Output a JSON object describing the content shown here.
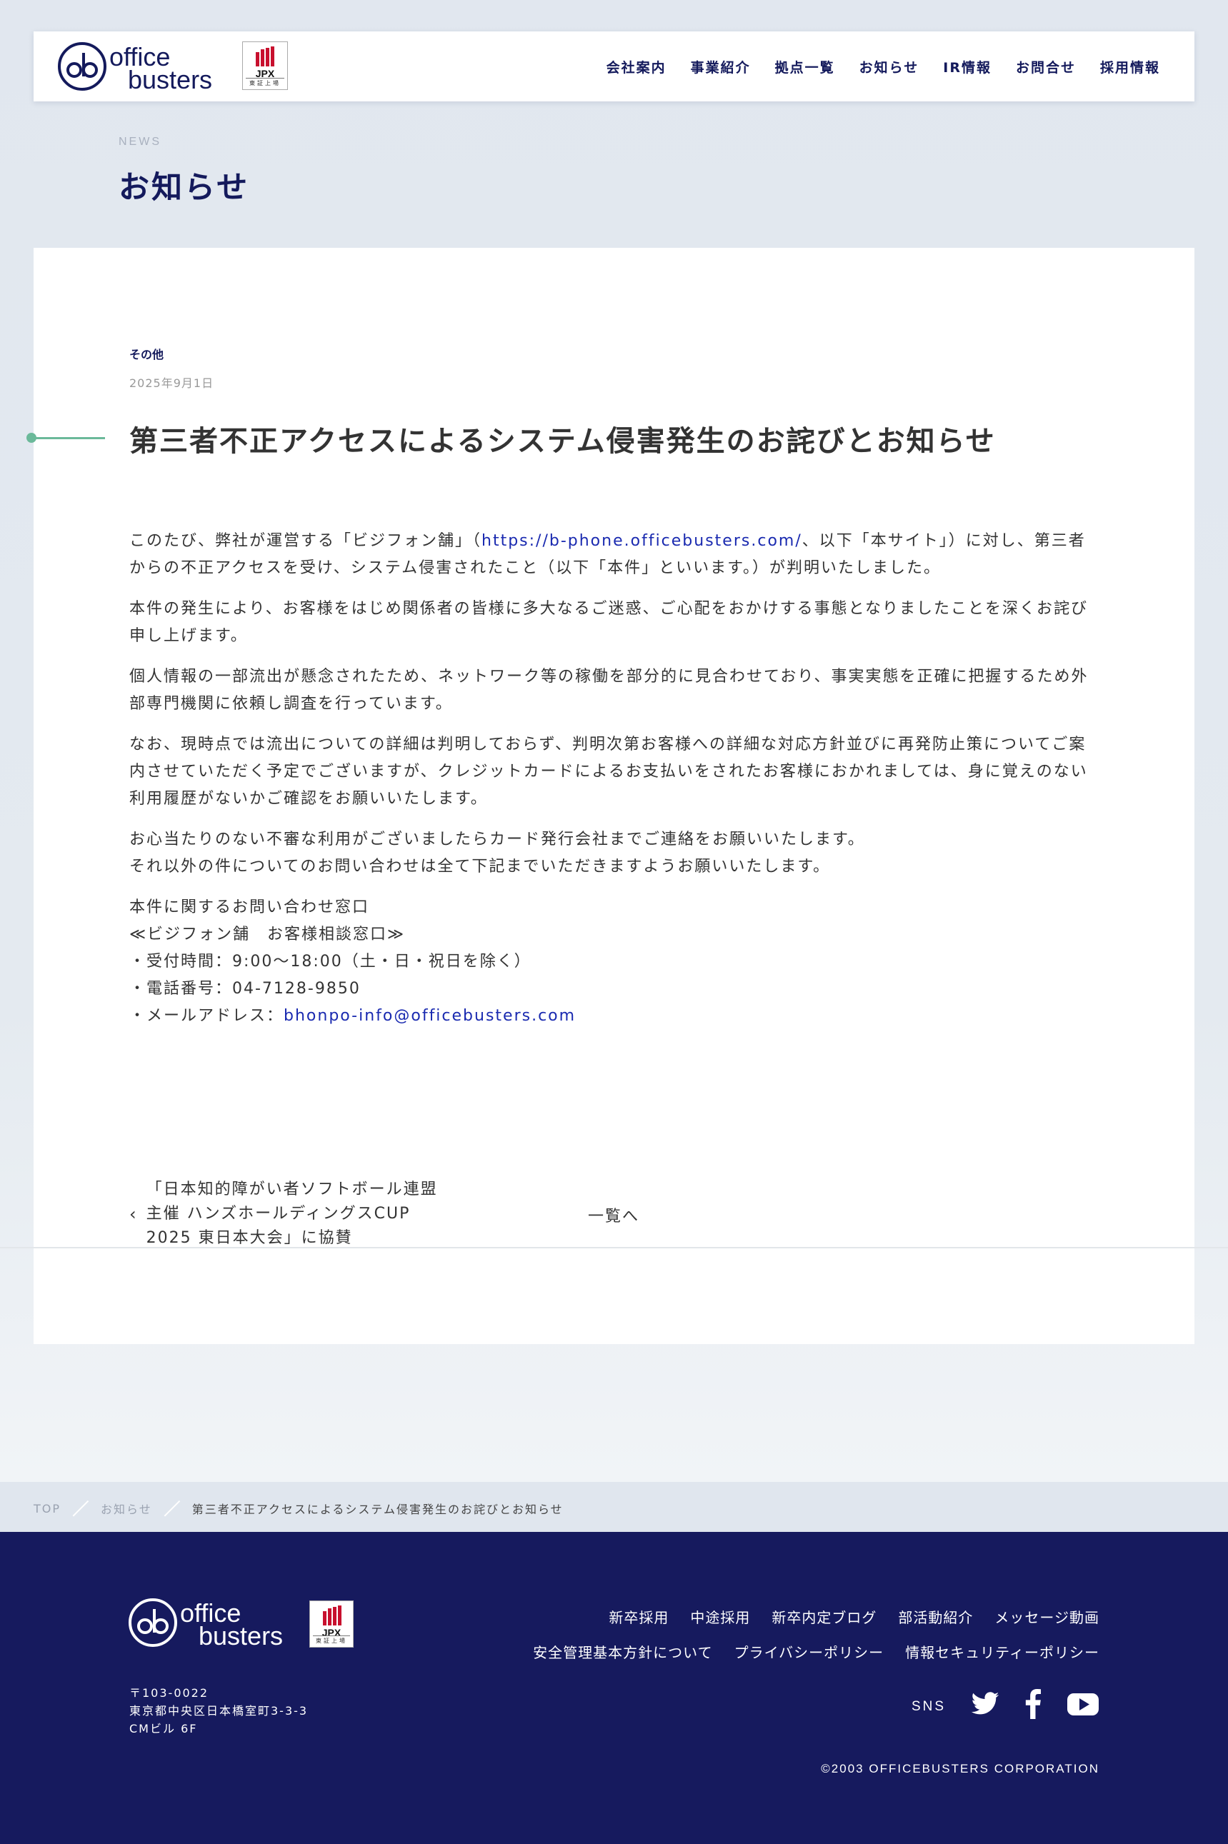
{
  "header": {
    "logo_text_1": "office",
    "logo_text_2": "busters",
    "jpx_label": "JPX",
    "jpx_sub": "東証上場",
    "nav": [
      "会社案内",
      "事業紹介",
      "拠点一覧",
      "お知らせ",
      "IR情報",
      "お問合せ",
      "採用情報"
    ]
  },
  "page": {
    "title_en": "NEWS",
    "title": "お知らせ"
  },
  "article": {
    "category": "その他",
    "date": "2025年9月1日",
    "title": "第三者不正アクセスによるシステム侵害発生のお詫びとお知らせ",
    "p1_before": "このたび、弊社が運営する「ビジフォン舗」（",
    "p1_link": "https://b-phone.officebusters.com/",
    "p1_after": "、以下「本サイト」）に対し、第三者からの不正アクセスを受け、システム侵害されたこと（以下「本件」といいます。）が判明いたしました。",
    "p2": "本件の発生により、お客様をはじめ関係者の皆様に多大なるご迷惑、ご心配をおかけする事態となりましたことを深くお詫び申し上げます。",
    "p3": "個人情報の一部流出が懸念されたため、ネットワーク等の稼働を部分的に見合わせており、事実実態を正確に把握するため外部専門機関に依頼し調査を行っています。",
    "p4": "なお、現時点では流出についての詳細は判明しておらず、判明次第お客様への詳細な対応方針並びに再発防止策についてご案内させていただく予定でございますが、クレジットカードによるお支払いをされたお客様におかれましては、身に覚えのない利用履歴がないかご確認をお願いいたします。",
    "p5_line1": "お心当たりのない不審な利用がございましたらカード発行会社までご連絡をお願いいたします。",
    "p5_line2": "それ以外の件についてのお問い合わせは全て下記までいただきますようお願いいたします。",
    "contact_heading": "本件に関するお問い合わせ窓口",
    "contact_name": "≪ビジフォン舗　お客様相談窓口≫",
    "contact_hours": "・受付時間：9:00〜18:00（土・日・祝日を除く）",
    "contact_phone": "・電話番号：04-7128-9850",
    "contact_email_label": "・メールアドレス：",
    "contact_email": "bhonpo-info@officebusters.com"
  },
  "pager": {
    "prev_arrow": "‹",
    "prev_title": "「日本知的障がい者ソフトボール連盟主催 ハンズホールディングスCUP 2025 東日本大会」に協賛",
    "list_label": "一覧へ"
  },
  "breadcrumb": {
    "top": "TOP",
    "news": "お知らせ",
    "current": "第三者不正アクセスによるシステム侵害発生のお詫びとお知らせ"
  },
  "footer": {
    "nav_row1": [
      "新卒採用",
      "中途採用",
      "新卒内定ブログ",
      "部活動紹介",
      "メッセージ動画"
    ],
    "nav_row2": [
      "安全管理基本方針について",
      "プライバシーポリシー",
      "情報セキュリティーポリシー"
    ],
    "address_zip": "〒103-0022",
    "address_line1": "東京都中央区日本橋室町3-3-3",
    "address_line2": "CMビル 6F",
    "sns_label": "SNS",
    "sns_icons": [
      "twitter-icon",
      "facebook-icon",
      "youtube-icon"
    ],
    "copyright": "©2003 OFFICEBUSTERS CORPORATION"
  },
  "colors": {
    "brand_navy": "#141a5c",
    "footer_bg": "#161a5e",
    "accent_green": "#6bb99a",
    "link_blue": "#1a2ab0",
    "jpx_red": "#c8102e"
  }
}
